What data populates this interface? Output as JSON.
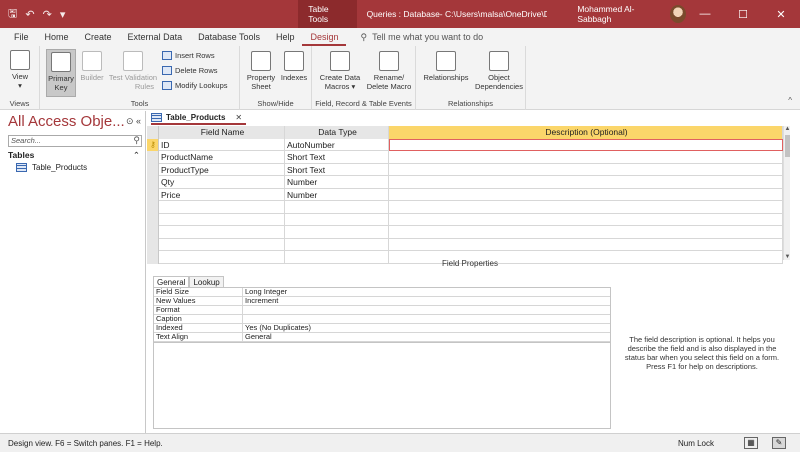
{
  "titlebar": {
    "qat": [
      "🖫",
      "↶",
      "↷",
      "▾"
    ],
    "context_tab": "Table Tools",
    "title": "Queries : Database- C:\\Users\\malsa\\OneDrive\\Docume...",
    "user": "Mohammed Al-Sabbagh",
    "minimize": "—",
    "restore": "☐",
    "close": "✕"
  },
  "menu": {
    "tabs": [
      "File",
      "Home",
      "Create",
      "External Data",
      "Database Tools",
      "Help",
      "Design"
    ],
    "active": "Design",
    "tellme": "Tell me what you want to do"
  },
  "ribbon": {
    "views": {
      "view": "View",
      "label": "Views"
    },
    "tools": {
      "primary_key_1": "Primary",
      "primary_key_2": "Key",
      "builder": "Builder",
      "test_1": "Test Validation",
      "test_2": "Rules",
      "insert_rows": "Insert Rows",
      "delete_rows": "Delete Rows",
      "modify_lookups": "Modify Lookups",
      "label": "Tools"
    },
    "showhide": {
      "prop_1": "Property",
      "prop_2": "Sheet",
      "indexes": "Indexes",
      "label": "Show/Hide"
    },
    "events": {
      "create_1": "Create Data",
      "create_2": "Macros ▾",
      "rename_1": "Rename/",
      "rename_2": "Delete Macro",
      "label": "Field, Record & Table Events"
    },
    "relationships": {
      "rel": "Relationships",
      "objdep_1": "Object",
      "objdep_2": "Dependencies",
      "label": "Relationships"
    },
    "collapse": "^"
  },
  "nav": {
    "title": "All Access Obje...",
    "tools": "⊙ «",
    "search_placeholder": "Search...",
    "section": "Tables",
    "chevron": "⌃",
    "item": "Table_Products"
  },
  "doc": {
    "tab": "Table_Products",
    "close": "✕",
    "headers": [
      "Field Name",
      "Data Type",
      "Description (Optional)"
    ],
    "rows": [
      {
        "name": "ID",
        "type": "AutoNumber"
      },
      {
        "name": "ProductName",
        "type": "Short Text"
      },
      {
        "name": "ProductType",
        "type": "Short Text"
      },
      {
        "name": "Qty",
        "type": "Number"
      },
      {
        "name": "Price",
        "type": "Number"
      }
    ],
    "field_properties": "Field Properties",
    "prop_tabs": [
      "General",
      "Lookup"
    ],
    "props": [
      {
        "k": "Field Size",
        "v": "Long Integer"
      },
      {
        "k": "New Values",
        "v": "Increment"
      },
      {
        "k": "Format",
        "v": ""
      },
      {
        "k": "Caption",
        "v": ""
      },
      {
        "k": "Indexed",
        "v": "Yes (No Duplicates)"
      },
      {
        "k": "Text Align",
        "v": "General"
      }
    ],
    "help": "The field description is optional. It helps you describe the field and is also displayed in the status bar when you select this field on a form. Press F1 for help on descriptions."
  },
  "status": {
    "text": "Design view.  F6 = Switch panes.  F1 = Help.",
    "numlock": "Num Lock"
  }
}
